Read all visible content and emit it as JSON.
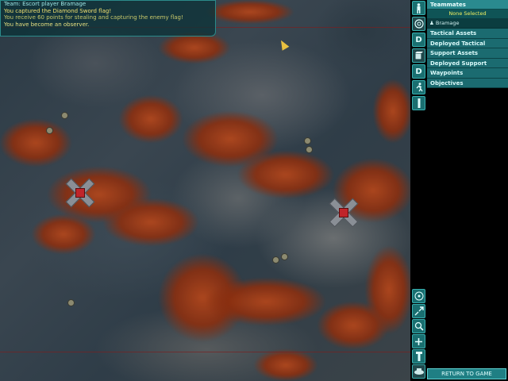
{
  "chat": {
    "lines": [
      "Team: Escort player Bramage",
      "You captured the Diamond Sword flag!",
      "You receive 60 points for stealing and capturing the enemy flag!",
      "You have become an observer."
    ]
  },
  "panel": {
    "teammates_header": "Teammates",
    "selection": "None Selected",
    "member": "Bramage",
    "categories": [
      "Tactical Assets",
      "Deployed Tactical",
      "Support Assets",
      "Deployed Support",
      "Waypoints",
      "Objectives"
    ],
    "return_button": "RETURN TO GAME"
  },
  "toolbar": {
    "icons": [
      "player-icon",
      "target-icon",
      "deployable-d-icon",
      "cube-icon",
      "deployable-d-icon",
      "running-man-icon",
      "beacon-icon"
    ],
    "d_label": "D",
    "bottom_icons": [
      "radar-icon",
      "zoom-in-icon",
      "magnify-icon",
      "plus-icon",
      "tower-icon",
      "vehicle-icon"
    ]
  },
  "colors": {
    "panel_header": "#2a8a8f",
    "selection_text": "#f0f060",
    "enemy_core": "#c0252a"
  }
}
